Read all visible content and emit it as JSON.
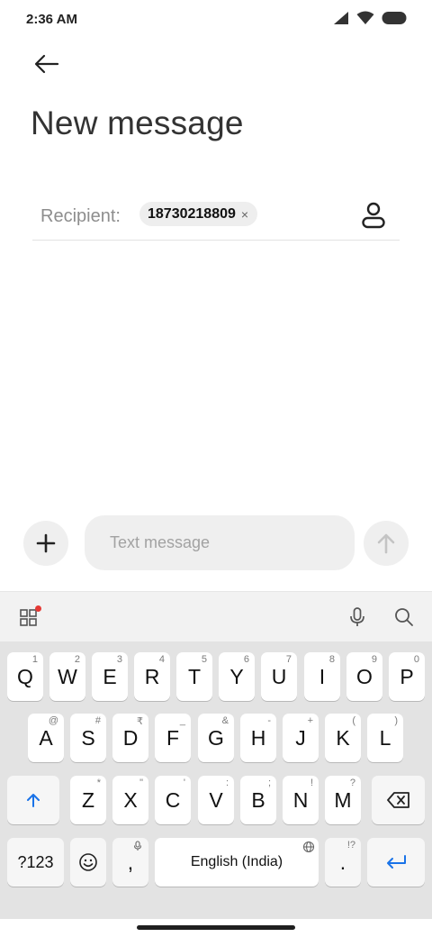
{
  "status_bar": {
    "time": "2:36 AM",
    "icons": [
      "signal-icon",
      "wifi-icon",
      "battery-icon"
    ]
  },
  "header": {
    "back_icon": "arrow-left-icon",
    "title": "New message"
  },
  "recipient": {
    "label": "Recipient:",
    "chip_text": "18730218809",
    "chip_close": "×",
    "contact_icon": "person-icon"
  },
  "compose": {
    "placeholder": "Text message",
    "value": "",
    "add_icon": "plus-icon",
    "send_icon": "arrow-up-icon"
  },
  "keyboard_toolbar": {
    "tools": [
      "apps-grid-icon",
      "mic-icon",
      "search-icon"
    ],
    "notification_color": "#e53935"
  },
  "keyboard": {
    "row1": [
      {
        "label": "Q",
        "hint": "1"
      },
      {
        "label": "W",
        "hint": "2"
      },
      {
        "label": "E",
        "hint": "3"
      },
      {
        "label": "R",
        "hint": "4"
      },
      {
        "label": "T",
        "hint": "5"
      },
      {
        "label": "Y",
        "hint": "6"
      },
      {
        "label": "U",
        "hint": "7"
      },
      {
        "label": "I",
        "hint": "8"
      },
      {
        "label": "O",
        "hint": "9"
      },
      {
        "label": "P",
        "hint": "0"
      }
    ],
    "row2": [
      {
        "label": "A",
        "hint": "@"
      },
      {
        "label": "S",
        "hint": "#"
      },
      {
        "label": "D",
        "hint": "₹"
      },
      {
        "label": "F",
        "hint": "_"
      },
      {
        "label": "G",
        "hint": "&"
      },
      {
        "label": "H",
        "hint": "-"
      },
      {
        "label": "J",
        "hint": "+"
      },
      {
        "label": "K",
        "hint": "("
      },
      {
        "label": "L",
        "hint": ")"
      }
    ],
    "row3": [
      {
        "label": "Z",
        "hint": "*"
      },
      {
        "label": "X",
        "hint": "\""
      },
      {
        "label": "C",
        "hint": "'"
      },
      {
        "label": "V",
        "hint": ":"
      },
      {
        "label": "B",
        "hint": ";"
      },
      {
        "label": "N",
        "hint": "!"
      },
      {
        "label": "M",
        "hint": "?"
      }
    ],
    "symbols_label": "?123",
    "comma_label": ",",
    "space_label": "English (India)",
    "period_label": ".",
    "period_hint": "!?",
    "accent_color": "#1a73e8"
  }
}
